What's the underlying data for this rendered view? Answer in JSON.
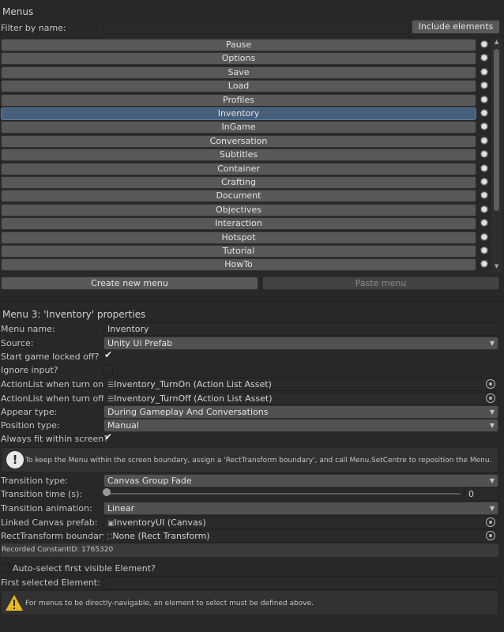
{
  "menus_header": "Menus",
  "filter": {
    "label": "Filter by name:",
    "value": "",
    "include_label": "Include elements"
  },
  "menu_items": [
    "Pause",
    "Options",
    "Save",
    "Load",
    "Profiles",
    "Inventory",
    "InGame",
    "Conversation",
    "Subtitles",
    "Container",
    "Crafting",
    "Document",
    "Objectives",
    "Interaction",
    "Hotspot",
    "Tutorial",
    "HowTo"
  ],
  "selected_index": 5,
  "create_menu_label": "Create new menu",
  "paste_menu_label": "Paste menu",
  "properties": {
    "title": "Menu 3: 'Inventory' properties",
    "menu_name_label": "Menu name:",
    "menu_name_value": "Inventory",
    "source_label": "Source:",
    "source_value": "Unity Ui Prefab",
    "start_locked_label": "Start game locked off?",
    "start_locked_checked": true,
    "ignore_input_label": "Ignore input?",
    "ignore_input_checked": false,
    "turn_on_label": "ActionList when turn on:",
    "turn_on_value": "Inventory_TurnOn (Action List Asset)",
    "turn_off_label": "ActionList when turn off:",
    "turn_off_value": "Inventory_TurnOff (Action List Asset)",
    "appear_label": "Appear type:",
    "appear_value": "During Gameplay And Conversations",
    "position_label": "Position type:",
    "position_value": "Manual",
    "fit_label": "Always fit within screen?",
    "fit_checked": true,
    "fit_help": "To keep the Menu within the screen boundary, assign a 'RectTransform boundary', and call Menu.SetCentre to reposition the Menu.",
    "transition_type_label": "Transition type:",
    "transition_type_value": "Canvas Group Fade",
    "transition_time_label": "Transition time (s):",
    "transition_time_value": "0",
    "transition_anim_label": "Transition animation:",
    "transition_anim_value": "Linear",
    "canvas_label": "Linked Canvas prefab:",
    "canvas_value": "InventoryUI (Canvas)",
    "rect_label": "RectTransform boundary:",
    "rect_value": "None (Rect Transform)",
    "constant_id": "Recorded ConstantID: 1765320",
    "auto_select_label": "Auto-select first visible Element?",
    "auto_select_checked": false,
    "first_selected_label": "First selected Element:",
    "first_selected_value": "",
    "warning_text": "For menus to be directly-navigable, an element to select must be defined above."
  }
}
